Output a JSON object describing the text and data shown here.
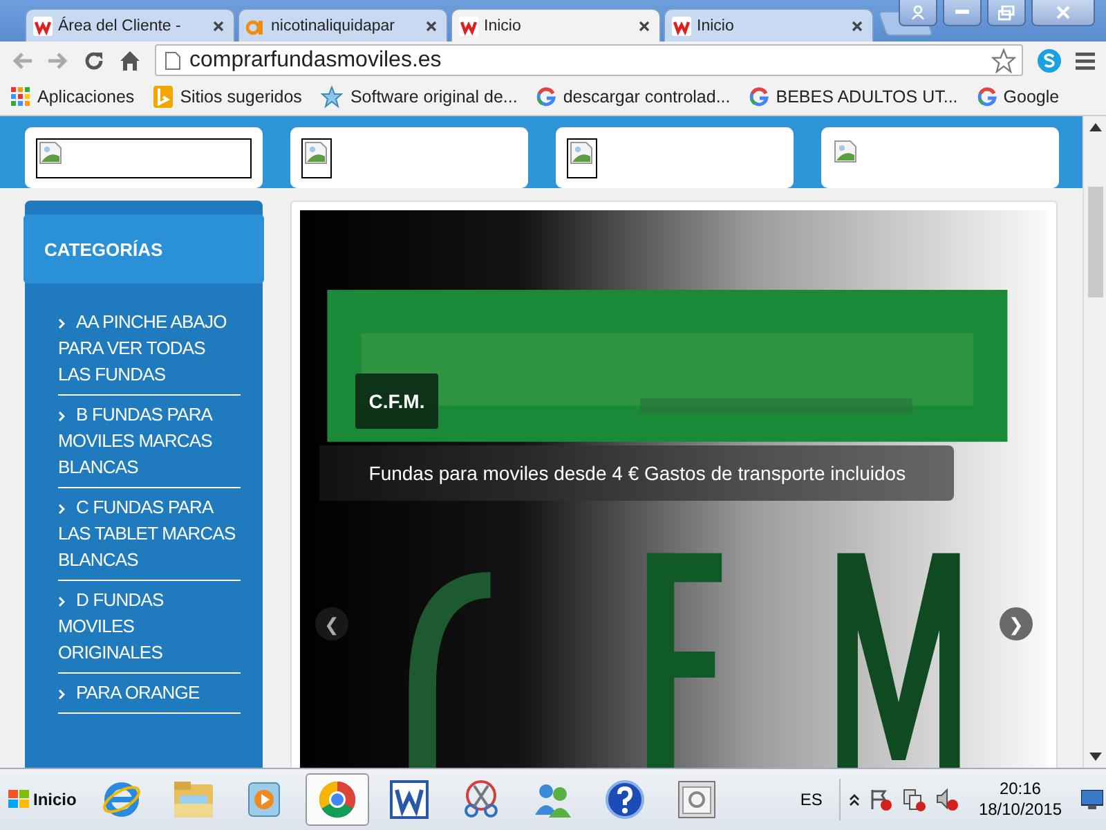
{
  "browser": {
    "tabs": [
      {
        "title": "Área del Cliente - ",
        "kind": "red",
        "selected": false
      },
      {
        "title": "nicotinaliquidapar",
        "kind": "orange",
        "selected": false
      },
      {
        "title": "Inicio",
        "kind": "red",
        "selected": true
      },
      {
        "title": "Inicio",
        "kind": "red",
        "selected": false
      }
    ],
    "address": "comprarfundasmoviles.es",
    "bookmarks": [
      {
        "label": "Aplicaciones",
        "kind": "apps"
      },
      {
        "label": "Sitios sugeridos",
        "kind": "bing"
      },
      {
        "label": "Software original de...",
        "kind": "star"
      },
      {
        "label": "descargar controlad...",
        "kind": "google"
      },
      {
        "label": "BEBES ADULTOS UT...",
        "kind": "google"
      },
      {
        "label": "Google",
        "kind": "google"
      }
    ]
  },
  "page": {
    "image_cards": [
      {
        "kind": "wide-frame"
      },
      {
        "kind": "frame"
      },
      {
        "kind": "frame"
      },
      {
        "kind": "plain"
      }
    ],
    "sidebar": {
      "title": "CATEGORÍAS",
      "items": [
        {
          "label": "AA PINCHE ABAJO PARA VER TODAS LAS FUNDAS"
        },
        {
          "label": "B FUNDAS PARA MOVILES MARCAS BLANCAS"
        },
        {
          "label": "C FUNDAS PARA LAS TABLET MARCAS BLANCAS"
        },
        {
          "label": "D FUNDAS MOVILES ORIGINALES"
        },
        {
          "label": "PARA ORANGE"
        }
      ]
    },
    "slider": {
      "kind": "picture",
      "caption_title": "C.F.M.",
      "caption_text": "Fundas para moviles desde 4 € Gastos de transporte incluidos",
      "prev": "❮",
      "next": "❯"
    }
  },
  "taskbar": {
    "start": "Inicio",
    "apps": [
      {
        "kind": "ie",
        "selected": false
      },
      {
        "kind": "folder",
        "selected": false
      },
      {
        "kind": "media",
        "selected": false
      },
      {
        "kind": "chrome",
        "selected": true
      },
      {
        "kind": "word",
        "selected": false
      },
      {
        "kind": "scissors",
        "selected": false
      },
      {
        "kind": "people",
        "selected": false
      },
      {
        "kind": "help",
        "selected": false
      },
      {
        "kind": "window",
        "selected": false
      }
    ],
    "language": "ES",
    "time": "20:16",
    "date": "18/10/2015"
  }
}
